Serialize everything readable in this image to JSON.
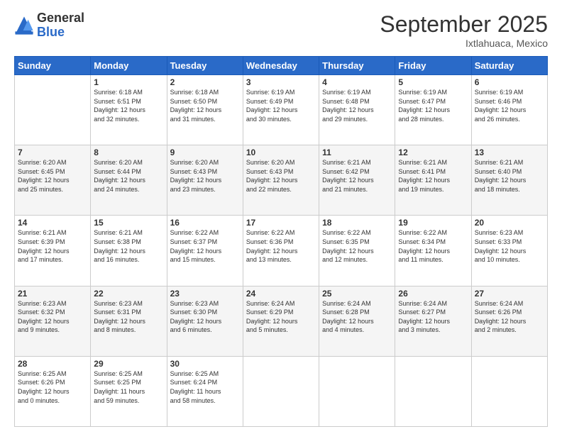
{
  "logo": {
    "general": "General",
    "blue": "Blue"
  },
  "header": {
    "month": "September 2025",
    "location": "Ixtlahuaca, Mexico"
  },
  "weekdays": [
    "Sunday",
    "Monday",
    "Tuesday",
    "Wednesday",
    "Thursday",
    "Friday",
    "Saturday"
  ],
  "weeks": [
    [
      {
        "day": "",
        "info": ""
      },
      {
        "day": "1",
        "info": "Sunrise: 6:18 AM\nSunset: 6:51 PM\nDaylight: 12 hours\nand 32 minutes."
      },
      {
        "day": "2",
        "info": "Sunrise: 6:18 AM\nSunset: 6:50 PM\nDaylight: 12 hours\nand 31 minutes."
      },
      {
        "day": "3",
        "info": "Sunrise: 6:19 AM\nSunset: 6:49 PM\nDaylight: 12 hours\nand 30 minutes."
      },
      {
        "day": "4",
        "info": "Sunrise: 6:19 AM\nSunset: 6:48 PM\nDaylight: 12 hours\nand 29 minutes."
      },
      {
        "day": "5",
        "info": "Sunrise: 6:19 AM\nSunset: 6:47 PM\nDaylight: 12 hours\nand 28 minutes."
      },
      {
        "day": "6",
        "info": "Sunrise: 6:19 AM\nSunset: 6:46 PM\nDaylight: 12 hours\nand 26 minutes."
      }
    ],
    [
      {
        "day": "7",
        "info": "Sunrise: 6:20 AM\nSunset: 6:45 PM\nDaylight: 12 hours\nand 25 minutes."
      },
      {
        "day": "8",
        "info": "Sunrise: 6:20 AM\nSunset: 6:44 PM\nDaylight: 12 hours\nand 24 minutes."
      },
      {
        "day": "9",
        "info": "Sunrise: 6:20 AM\nSunset: 6:43 PM\nDaylight: 12 hours\nand 23 minutes."
      },
      {
        "day": "10",
        "info": "Sunrise: 6:20 AM\nSunset: 6:43 PM\nDaylight: 12 hours\nand 22 minutes."
      },
      {
        "day": "11",
        "info": "Sunrise: 6:21 AM\nSunset: 6:42 PM\nDaylight: 12 hours\nand 21 minutes."
      },
      {
        "day": "12",
        "info": "Sunrise: 6:21 AM\nSunset: 6:41 PM\nDaylight: 12 hours\nand 19 minutes."
      },
      {
        "day": "13",
        "info": "Sunrise: 6:21 AM\nSunset: 6:40 PM\nDaylight: 12 hours\nand 18 minutes."
      }
    ],
    [
      {
        "day": "14",
        "info": "Sunrise: 6:21 AM\nSunset: 6:39 PM\nDaylight: 12 hours\nand 17 minutes."
      },
      {
        "day": "15",
        "info": "Sunrise: 6:21 AM\nSunset: 6:38 PM\nDaylight: 12 hours\nand 16 minutes."
      },
      {
        "day": "16",
        "info": "Sunrise: 6:22 AM\nSunset: 6:37 PM\nDaylight: 12 hours\nand 15 minutes."
      },
      {
        "day": "17",
        "info": "Sunrise: 6:22 AM\nSunset: 6:36 PM\nDaylight: 12 hours\nand 13 minutes."
      },
      {
        "day": "18",
        "info": "Sunrise: 6:22 AM\nSunset: 6:35 PM\nDaylight: 12 hours\nand 12 minutes."
      },
      {
        "day": "19",
        "info": "Sunrise: 6:22 AM\nSunset: 6:34 PM\nDaylight: 12 hours\nand 11 minutes."
      },
      {
        "day": "20",
        "info": "Sunrise: 6:23 AM\nSunset: 6:33 PM\nDaylight: 12 hours\nand 10 minutes."
      }
    ],
    [
      {
        "day": "21",
        "info": "Sunrise: 6:23 AM\nSunset: 6:32 PM\nDaylight: 12 hours\nand 9 minutes."
      },
      {
        "day": "22",
        "info": "Sunrise: 6:23 AM\nSunset: 6:31 PM\nDaylight: 12 hours\nand 8 minutes."
      },
      {
        "day": "23",
        "info": "Sunrise: 6:23 AM\nSunset: 6:30 PM\nDaylight: 12 hours\nand 6 minutes."
      },
      {
        "day": "24",
        "info": "Sunrise: 6:24 AM\nSunset: 6:29 PM\nDaylight: 12 hours\nand 5 minutes."
      },
      {
        "day": "25",
        "info": "Sunrise: 6:24 AM\nSunset: 6:28 PM\nDaylight: 12 hours\nand 4 minutes."
      },
      {
        "day": "26",
        "info": "Sunrise: 6:24 AM\nSunset: 6:27 PM\nDaylight: 12 hours\nand 3 minutes."
      },
      {
        "day": "27",
        "info": "Sunrise: 6:24 AM\nSunset: 6:26 PM\nDaylight: 12 hours\nand 2 minutes."
      }
    ],
    [
      {
        "day": "28",
        "info": "Sunrise: 6:25 AM\nSunset: 6:26 PM\nDaylight: 12 hours\nand 0 minutes."
      },
      {
        "day": "29",
        "info": "Sunrise: 6:25 AM\nSunset: 6:25 PM\nDaylight: 11 hours\nand 59 minutes."
      },
      {
        "day": "30",
        "info": "Sunrise: 6:25 AM\nSunset: 6:24 PM\nDaylight: 11 hours\nand 58 minutes."
      },
      {
        "day": "",
        "info": ""
      },
      {
        "day": "",
        "info": ""
      },
      {
        "day": "",
        "info": ""
      },
      {
        "day": "",
        "info": ""
      }
    ]
  ]
}
